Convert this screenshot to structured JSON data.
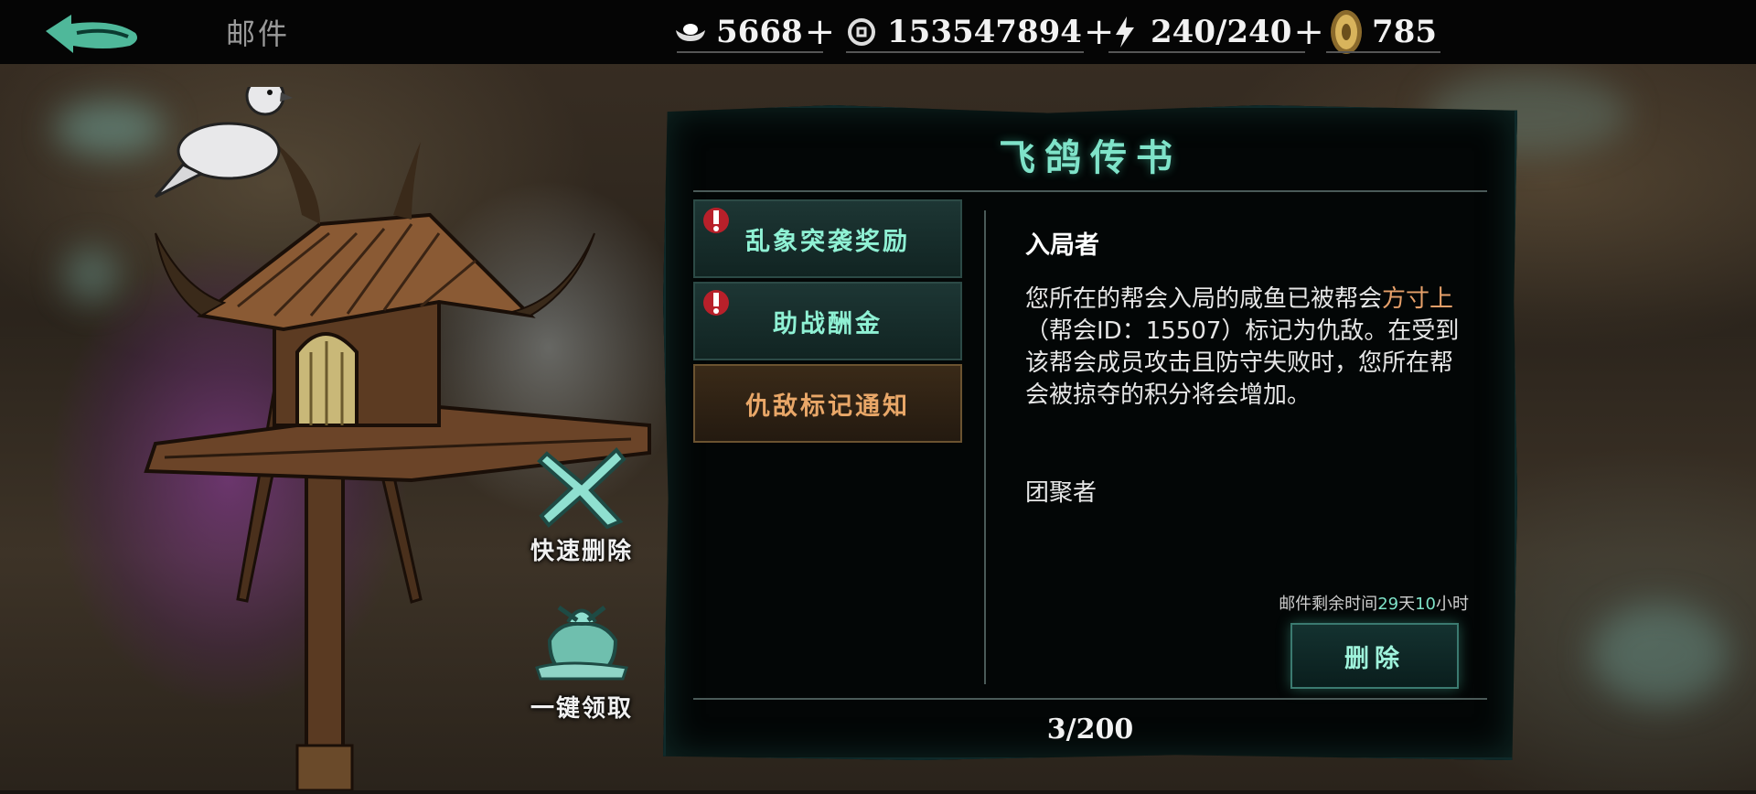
{
  "header": {
    "title": "邮件",
    "resources": [
      {
        "icon": "silver-ingot-icon",
        "value": "5668"
      },
      {
        "icon": "coin-icon",
        "value": "153547894"
      },
      {
        "icon": "lightning-icon",
        "value": "240/240"
      },
      {
        "icon": "gold-coin-icon",
        "value": "785"
      }
    ],
    "plus": "+"
  },
  "side_actions": {
    "quick_delete": "快速删除",
    "claim_all": "一键领取"
  },
  "panel": {
    "title": "飞鸽传书",
    "mail_list": [
      {
        "label": "乱象突袭奖励",
        "alert": true
      },
      {
        "label": "助战酬金",
        "alert": true
      },
      {
        "label": "仇敌标记通知",
        "alert": false,
        "selected": true
      }
    ],
    "mail": {
      "sender": "入局者",
      "body_part1": "您所在的帮会入局的咸鱼已被帮会",
      "body_highlight": "方寸上",
      "body_part2": "（帮会ID：15507）标记为仇敌。在受到该帮会成员攻击且防守失败时，您所在帮会被掠夺的积分将会增加。",
      "signature": "团聚者"
    },
    "expire": {
      "prefix": "邮件剩余时间",
      "days": "29",
      "day_unit": "天",
      "hours": "10",
      "hour_unit": "小时"
    },
    "delete_label": "删除",
    "page_count": "3/200"
  },
  "colors": {
    "accent_teal": "#7fe3c9",
    "highlight_orange": "#e6a06a"
  }
}
